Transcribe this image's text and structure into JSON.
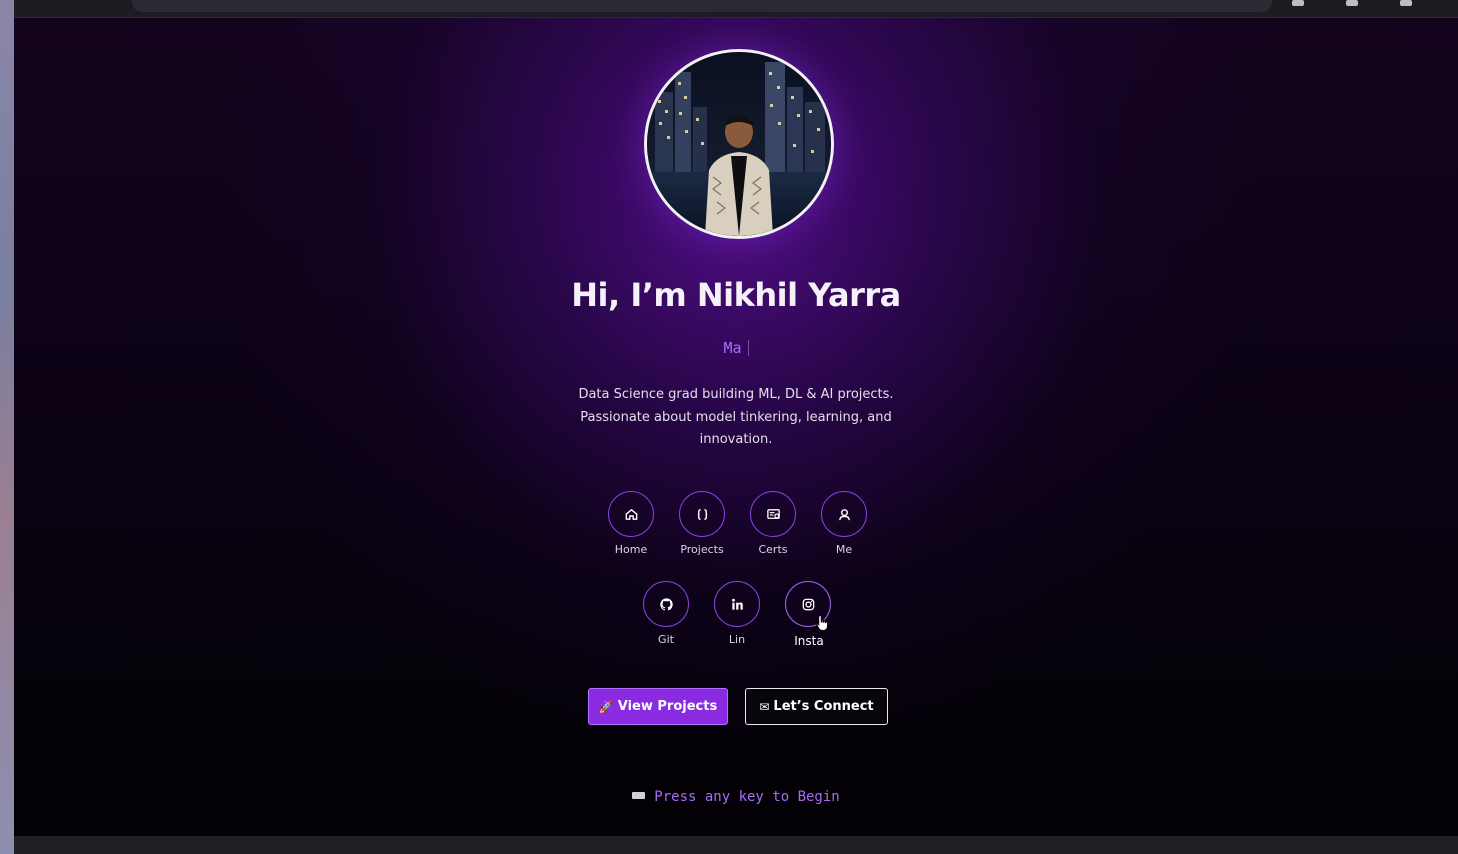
{
  "hero": {
    "title": "Hi, I’m Nikhil Yarra",
    "typing_text": "Ma",
    "description": "Data Science grad building ML, DL & AI projects. Passionate about model tinkering, learning, and innovation."
  },
  "nav": {
    "items": [
      {
        "label": "Home",
        "icon": "home-icon"
      },
      {
        "label": "Projects",
        "icon": "code-braces-icon"
      },
      {
        "label": "Certs",
        "icon": "certificate-icon"
      },
      {
        "label": "Me",
        "icon": "user-icon"
      }
    ]
  },
  "social": {
    "items": [
      {
        "label": "Git",
        "icon": "github-icon"
      },
      {
        "label": "Lin",
        "icon": "linkedin-icon"
      },
      {
        "label": "Insta",
        "icon": "instagram-icon"
      }
    ]
  },
  "actions": {
    "primary_emoji": "🚀",
    "primary_label": "View Projects",
    "secondary_emoji": "✉",
    "secondary_label": "Let’s Connect"
  },
  "footer": {
    "prompt": "Press any key to Begin"
  },
  "colors": {
    "accent": "#8a2be2",
    "accent_light": "#b06cff",
    "background": "#0a0212",
    "glow": "#7814c8"
  }
}
